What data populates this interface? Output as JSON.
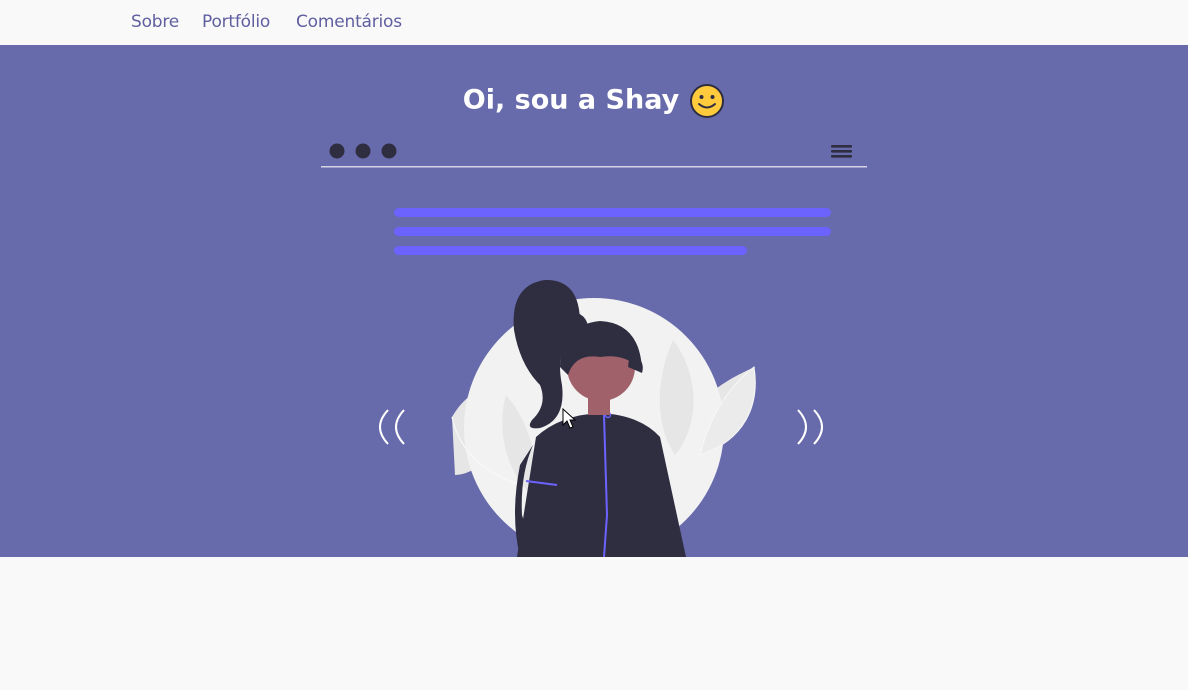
{
  "nav": {
    "items": [
      {
        "label": "Sobre"
      },
      {
        "label": "Portfólio"
      },
      {
        "label": "Comentários"
      }
    ]
  },
  "hero": {
    "title": "Oi, sou a Shay",
    "emoji_icon": "slightly-smiling-face-icon",
    "background_color": "#676aab",
    "accent_color": "#6c63ff"
  },
  "carousel": {
    "prev_icon": "double-chevron-left-icon",
    "next_icon": "double-chevron-right-icon"
  }
}
